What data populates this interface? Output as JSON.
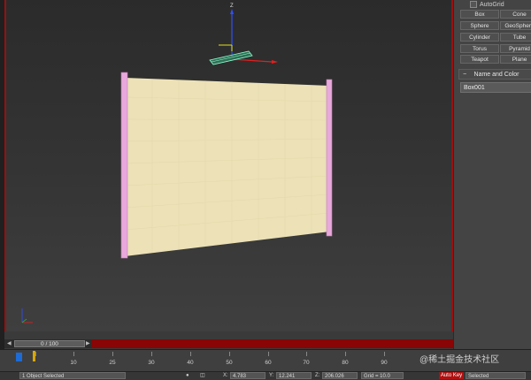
{
  "command_panel": {
    "autogrid_label": "AutoGrid",
    "object_buttons": [
      "Box",
      "Cone",
      "Sphere",
      "GeoSphere",
      "Cylinder",
      "Tube",
      "Torus",
      "Pyramid",
      "Teapot",
      "Plane"
    ],
    "rollout_title": "Name and Color",
    "object_name": "Box001"
  },
  "viewport": {
    "gizmo_axis_z": "Z",
    "tripod_axis_z": "Z",
    "tripod_axis_x": "X"
  },
  "timeline": {
    "slider_label": "0 / 100",
    "ticks": [
      "10",
      "20",
      "25",
      "30",
      "40",
      "50",
      "60",
      "70",
      "75",
      "80",
      "90"
    ],
    "current_frame_marker": "0"
  },
  "status": {
    "selection_text": "1 Object Selected",
    "x_label": "X:",
    "x_value": "4.783",
    "y_label": "Y:",
    "y_value": "12.241",
    "z_label": "Z:",
    "z_value": "206.026",
    "grid_text": "Grid = 10.0",
    "autokey_label": "Auto Key",
    "selected_dropdown": "Selected"
  },
  "watermark": "@稀土掘金技术社区",
  "colors": {
    "panel_bg": "#444444",
    "viewport_border": "#9a1010",
    "timeline_red": "#8a0505",
    "plane_fill": "#eee3b8",
    "frame_pink": "#e8a6d8",
    "autokey_red": "#b01010"
  }
}
